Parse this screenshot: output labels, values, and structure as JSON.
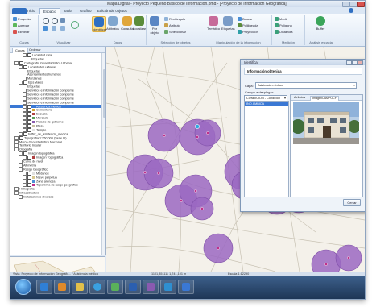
{
  "window": {
    "title": "Mapa Digital - Proyecto Pequeño Básico de Información.pmd - [Proyecto de Información Geográfica]"
  },
  "ribbon_tabs": [
    {
      "label": "",
      "kind": "file"
    },
    {
      "label": "Inicio",
      "kind": "tab"
    },
    {
      "label": "Espacio",
      "kind": "active"
    },
    {
      "label": "Tabla",
      "kind": "tab"
    },
    {
      "label": "Gráfico",
      "kind": "tab"
    },
    {
      "label": "Edición de objetos",
      "kind": "tab"
    }
  ],
  "ribbon": {
    "groups": [
      {
        "label": "Capas"
      },
      {
        "label": "Visualizar"
      },
      {
        "label": "Datos"
      },
      {
        "label": "Selección de objetos"
      },
      {
        "label": "Manipulación de la información"
      },
      {
        "label": "Medición"
      },
      {
        "label": "Análisis espacial"
      }
    ],
    "buttons": {
      "proyectar": "Proyectar",
      "agregar": "Agregar",
      "eliminar": "Eliminar",
      "identificar": "Identificar",
      "atributos": "Atributos",
      "consulta": "Consulta",
      "localizar": "Localizar",
      "por_objeto": "Por objeto",
      "rectangulo": "Rectángulo",
      "atributo": "Atributo",
      "seleccionar": "Seleccionar",
      "tematico": "Temático",
      "etiquetas": "Etiquetas",
      "buscar": "Buscar",
      "polilineada": "Polilineada",
      "proyeccion": "Proyección",
      "medir": "Medir",
      "poligono": "Polígono",
      "distancia": "Distancia",
      "buffer": "Buffer"
    }
  },
  "left_panel": {
    "tabs": [
      "Capas",
      "Ordenar"
    ],
    "tree": [
      {
        "label": "Localidad rural",
        "indent": 3,
        "kind": "check"
      },
      {
        "label": "Etiquetas",
        "indent": 4,
        "kind": "plain"
      },
      {
        "label": "Cartografía Geoestadística Urbana",
        "indent": 1,
        "kind": "check"
      },
      {
        "label": "Localidades urbanas",
        "indent": 2,
        "kind": "check"
      },
      {
        "label": "Etiquetas",
        "indent": 3,
        "kind": "plain"
      },
      {
        "label": "Asentamientos humanos",
        "indent": 3,
        "kind": "plain"
      },
      {
        "label": "Manzanas",
        "indent": 3,
        "kind": "box"
      },
      {
        "label": "Ejes viales",
        "indent": 2,
        "kind": "check"
      },
      {
        "label": "Etiquetas",
        "indent": 3,
        "kind": "plain"
      },
      {
        "label": "Servicios e información compleme",
        "indent": 3,
        "kind": "box"
      },
      {
        "label": "Servicios e información compleme",
        "indent": 3,
        "kind": "box"
      },
      {
        "label": "Servicios e información compleme",
        "indent": 3,
        "kind": "box"
      },
      {
        "label": "Servicios e información compleme",
        "indent": 3,
        "kind": "box"
      },
      {
        "label": "Asistencia médica",
        "indent": 3,
        "kind": "sym",
        "highlight": true
      },
      {
        "label": "Cementerio",
        "indent": 3,
        "kind": "sym"
      },
      {
        "label": "Escuela",
        "indent": 3,
        "kind": "sym"
      },
      {
        "label": "Mercado",
        "indent": 3,
        "kind": "sym"
      },
      {
        "label": "Palacio de gobierno",
        "indent": 3,
        "kind": "sym"
      },
      {
        "label": "Plaza",
        "indent": 3,
        "kind": "sym"
      },
      {
        "label": "Templo",
        "indent": 3,
        "kind": "sym"
      },
      {
        "label": "buffer_de_asistencia_medica",
        "indent": 2,
        "kind": "check"
      },
      {
        "label": "Topografía 1:250 000 (Serie III)",
        "indent": 1,
        "kind": "check"
      },
      {
        "label": "Marco Geoestadístico Nacional",
        "indent": 1,
        "kind": "box"
      },
      {
        "label": "Territorio Insular",
        "indent": 1,
        "kind": "box"
      },
      {
        "label": "Orografía",
        "indent": 1,
        "kind": "box"
      },
      {
        "label": "Imagen topográfica",
        "indent": 2,
        "kind": "check"
      },
      {
        "label": "Imagen Topográfica",
        "indent": 3,
        "kind": "sym"
      },
      {
        "label": "Curva de nivel",
        "indent": 2,
        "kind": "box"
      },
      {
        "label": "Altimetría",
        "indent": 2,
        "kind": "box"
      },
      {
        "label": "Rasgo Geográfico",
        "indent": 2,
        "kind": "box"
      },
      {
        "label": "Médanos",
        "indent": 3,
        "kind": "sym"
      },
      {
        "label": "Nieve perpetua",
        "indent": 3,
        "kind": "sym"
      },
      {
        "label": "Zona arenosa",
        "indent": 3,
        "kind": "sym"
      },
      {
        "label": "Toponimia de rasgo geográfico",
        "indent": 3,
        "kind": "sym"
      },
      {
        "label": "Hidrografía",
        "indent": 1,
        "kind": "box"
      },
      {
        "label": "Infraestructura",
        "indent": 1,
        "kind": "box"
      },
      {
        "label": "Instalaciones diversas",
        "indent": 2,
        "kind": "box"
      }
    ]
  },
  "dialog": {
    "title": "Identificar",
    "header": "Información obtenida",
    "layer_label": "Capa:",
    "layer_value": "Asistencia médica",
    "fields_label": "Campo a desplegar:",
    "field_value": "CONDICION - Condición",
    "list_item": "INO AMBICA",
    "right_tabs": [
      "Atributos",
      "ImagenCAMPOCF"
    ],
    "close_label": "Cerrar"
  },
  "status": {
    "left": "Vista: Proyecto de Información Geográfic... / Asistencia médica",
    "coords": "1101,351111  1,741,101 m",
    "scale": "Escala 1:12290"
  },
  "colors": {
    "buffer_fill": "#9b69c2",
    "buffer_stroke": "#7f4fa8",
    "point": "#c0308a",
    "highlight": "#3a78d4",
    "road": "#c8c2b3"
  }
}
